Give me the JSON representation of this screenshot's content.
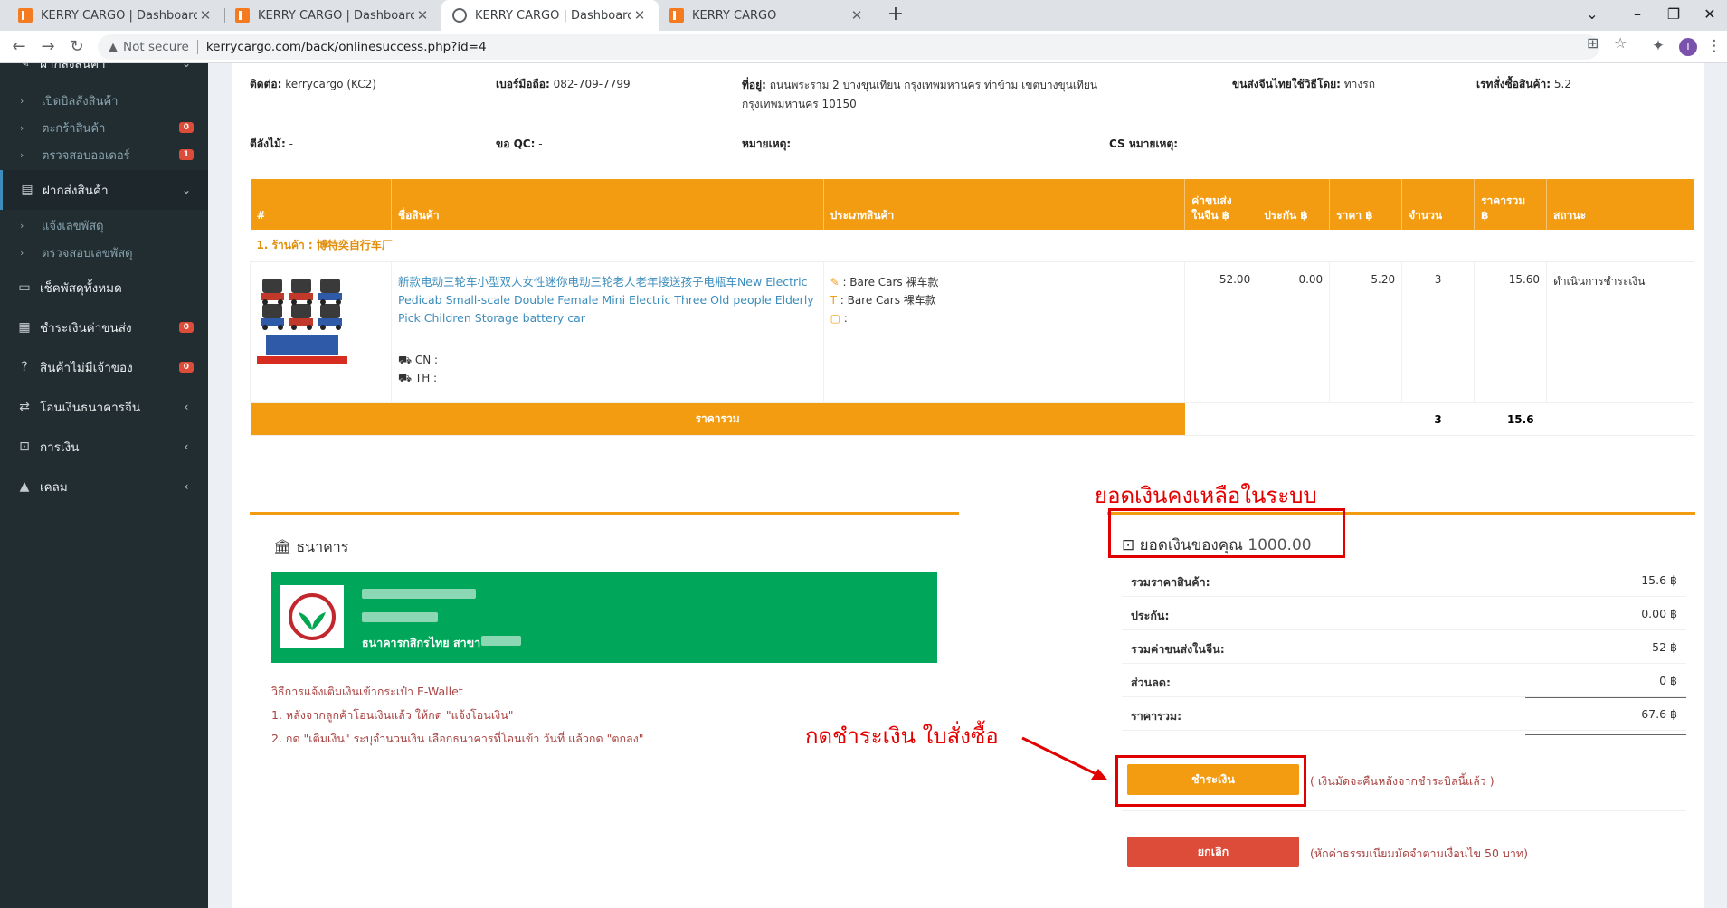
{
  "browser": {
    "tabs": [
      {
        "title": "KERRY CARGO | Dashboard",
        "close": "✕"
      },
      {
        "title": "KERRY CARGO | Dashboard",
        "close": "✕"
      },
      {
        "title": "KERRY CARGO | Dashboard",
        "close": "✕"
      },
      {
        "title": "KERRY CARGO",
        "close": "✕"
      }
    ],
    "new_tab": "+",
    "not_secure": "Not secure",
    "url": "kerrycargo.com/back/onlinesuccess.php?id=4",
    "profile_initial": "T"
  },
  "sidebar": {
    "section_top": "ฝากสั่งสินค้า",
    "sub_top": [
      {
        "label": "เปิดบิลสั่งสินค้า",
        "badge": ""
      },
      {
        "label": "ตะกร้าสินค้า",
        "badge": "0"
      },
      {
        "label": "ตรวจสอบออเดอร์",
        "badge": "1"
      }
    ],
    "section_ship": "ฝากส่งสินค้า",
    "sub_ship": [
      {
        "label": "แจ้งเลขพัสดุ"
      },
      {
        "label": "ตรวจสอบเลขพัสดุ"
      }
    ],
    "items": [
      {
        "label": "เช็คพัสดุทั้งหมด",
        "badge": ""
      },
      {
        "label": "ชำระเงินค่าขนส่ง",
        "badge": "0"
      },
      {
        "label": "สินค้าไม่มีเจ้าของ",
        "badge": "0"
      },
      {
        "label": "โอนเงินธนาคารจีน",
        "badge": ""
      },
      {
        "label": "การเงิน",
        "badge": ""
      },
      {
        "label": "เคลม",
        "badge": ""
      }
    ]
  },
  "info": {
    "contact_label": "ติดต่อ:",
    "contact_value": "kerrycargo (KC2)",
    "mobile_label": "เบอร์มือถือ:",
    "mobile_value": "082-709-7799",
    "address_label": "ที่อยู่:",
    "address_line1": "ถนนพระราม 2 บางขุนเทียน กรุงเทพมหานคร ท่าข้าม เขตบางขุนเทียน",
    "address_line2": "กรุงเทพมหานคร 10150",
    "shipping_label": "ขนส่งจีนไทยใช้วิธีโดย:",
    "shipping_value": "ทางรถ",
    "rate_label": "เรทสั่งซื้อสินค้า:",
    "rate_value": "5.2",
    "crate_label": "ตีลังไม้:",
    "crate_value": "-",
    "qc_label": "ขอ QC:",
    "qc_value": "-",
    "note_label": "หมายเหตุ:",
    "cs_note_label": "CS หมายเหตุ:"
  },
  "table": {
    "headers": [
      "#",
      "ชื่อสินค้า",
      "ประเภทสินค้า",
      "ค่าขนส่ง\nในจีน ฿",
      "ประกัน ฿",
      "ราคา ฿",
      "จำนวน",
      "ราคารวม\n฿",
      "สถานะ"
    ],
    "shop": "1. ร้านค้า : 博特奕自行车厂",
    "row": {
      "name": "新款电动三轮车小型双人女性迷你电动三轮老人老年接送孩子电瓶车New Electric Pedicab Small-scale Double Female Mini Electric Three Old people Elderly Pick Children Storage battery car",
      "cn": "CN :",
      "th": "TH :",
      "type1": ": Bare Cars 裸车款",
      "type2": ": Bare Cars 裸车款",
      "type3": ":",
      "ship_cn": "52.00",
      "insurance": "0.00",
      "price": "5.20",
      "qty": "3",
      "total": "15.60",
      "status": "ดำเนินการชำระเงิน"
    },
    "total_label": "ราคารวม",
    "total_qty": "3",
    "total_sum": "15.6"
  },
  "bank": {
    "heading": "ธนาคาร",
    "bank_name": "ธนาคารกสิกรไทย  สาขา",
    "wallet_title": "วิธีการแจ้งเติมเงินเข้ากระเป๋า E-Wallet",
    "step1": "1. หลังจากลูกค้าโอนเงินแล้ว ให้กด \"แจ้งโอนเงิน\"",
    "step2": "2. กด \"เติมเงิน\" ระบุจำนวนเงิน เลือกธนาคารที่โอนเข้า วันที่ แล้วกด \"ตกลง\""
  },
  "payment": {
    "balance_label": "ยอดเงินของคุณ",
    "balance_value": "1000.00",
    "rows": [
      {
        "label": "รวมราคาสินค้า:",
        "value": "15.6 ฿"
      },
      {
        "label": "ประกัน:",
        "value": "0.00 ฿"
      },
      {
        "label": "รวมค่าขนส่งในจีน:",
        "value": "52 ฿"
      },
      {
        "label": "ส่วนลด:",
        "value": "0 ฿"
      },
      {
        "label": "ราคารวม:",
        "value": "67.6 ฿"
      }
    ],
    "pay_button": "ชำระเงิน",
    "pay_note": "( เงินมัดจะคืนหลังจากชำระบิลนี้แล้ว )",
    "cancel_button": "ยกเลิก",
    "cancel_note": "(หักค่าธรรมเนียมมัดจำตามเงื่อนไข 50 บาท)"
  },
  "annotations": {
    "balance_note": "ยอดเงินคงเหลือในระบบ",
    "pay_note": "กดชำระเงิน ใบสั่งซื้อ"
  },
  "colors": {
    "accent": "#f39c12",
    "sidebar": "#222d32",
    "bank_green": "#00a65a",
    "cancel": "#dd4b39",
    "annotation": "#e00000"
  }
}
